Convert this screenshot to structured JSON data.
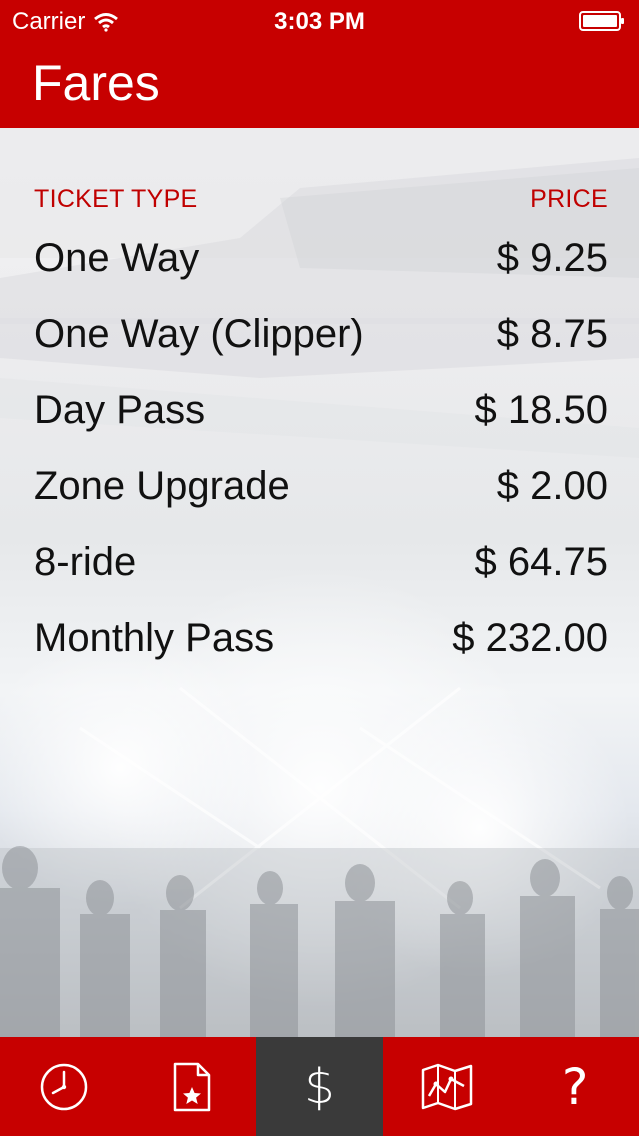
{
  "status_bar": {
    "carrier": "Carrier",
    "time": "3:03 PM"
  },
  "header": {
    "title": "Fares"
  },
  "fares": {
    "col_ticket": "TICKET TYPE",
    "col_price": "PRICE",
    "rows": [
      {
        "type": "One Way",
        "price": "$ 9.25"
      },
      {
        "type": "One Way (Clipper)",
        "price": "$ 8.75"
      },
      {
        "type": "Day Pass",
        "price": "$ 18.50"
      },
      {
        "type": "Zone Upgrade",
        "price": "$ 2.00"
      },
      {
        "type": "8-ride",
        "price": "$ 64.75"
      },
      {
        "type": "Monthly Pass",
        "price": "$ 232.00"
      }
    ]
  },
  "tabbar": {
    "active": "fares",
    "tabs": [
      {
        "icon": "clock-icon"
      },
      {
        "icon": "starred-document-icon"
      },
      {
        "icon": "dollar-icon",
        "glyph": "$"
      },
      {
        "icon": "map-icon"
      },
      {
        "icon": "question-icon",
        "glyph": "?"
      }
    ]
  },
  "colors": {
    "brand_red": "#c70000",
    "header_text_red": "#c00000",
    "active_tab": "#3a3a3a"
  }
}
